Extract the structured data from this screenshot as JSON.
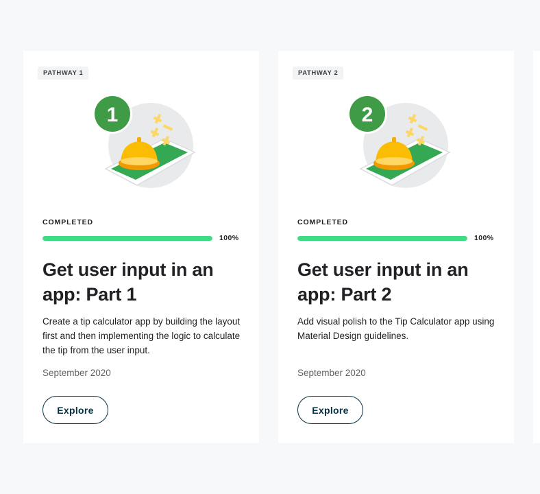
{
  "cards": [
    {
      "pathway": "PATHWAY 1",
      "number": "1",
      "status": "COMPLETED",
      "progress": 1.0,
      "progress_label": "100%",
      "title": "Get user input in an app: Part 1",
      "description": "Create a tip calculator app by building the layout first and then implementing the logic to calculate the tip from the user input.",
      "date": "September 2020",
      "button_label": "Explore"
    },
    {
      "pathway": "PATHWAY 2",
      "number": "2",
      "status": "COMPLETED",
      "progress": 1.0,
      "progress_label": "100%",
      "title": "Get user input in an app: Part 2",
      "description": "Add visual polish to the Tip Calculator app using Material Design guidelines.",
      "date": "September 2020",
      "button_label": "Explore"
    }
  ],
  "colors": {
    "progress_fill": "#3ddc84",
    "badge_circle": "#3f9b46",
    "button_border": "#073042",
    "bell": "#fbbc04",
    "mat_green": "#34a853"
  },
  "icons": [
    "service-bell-icon",
    "plus-minus-icon"
  ]
}
